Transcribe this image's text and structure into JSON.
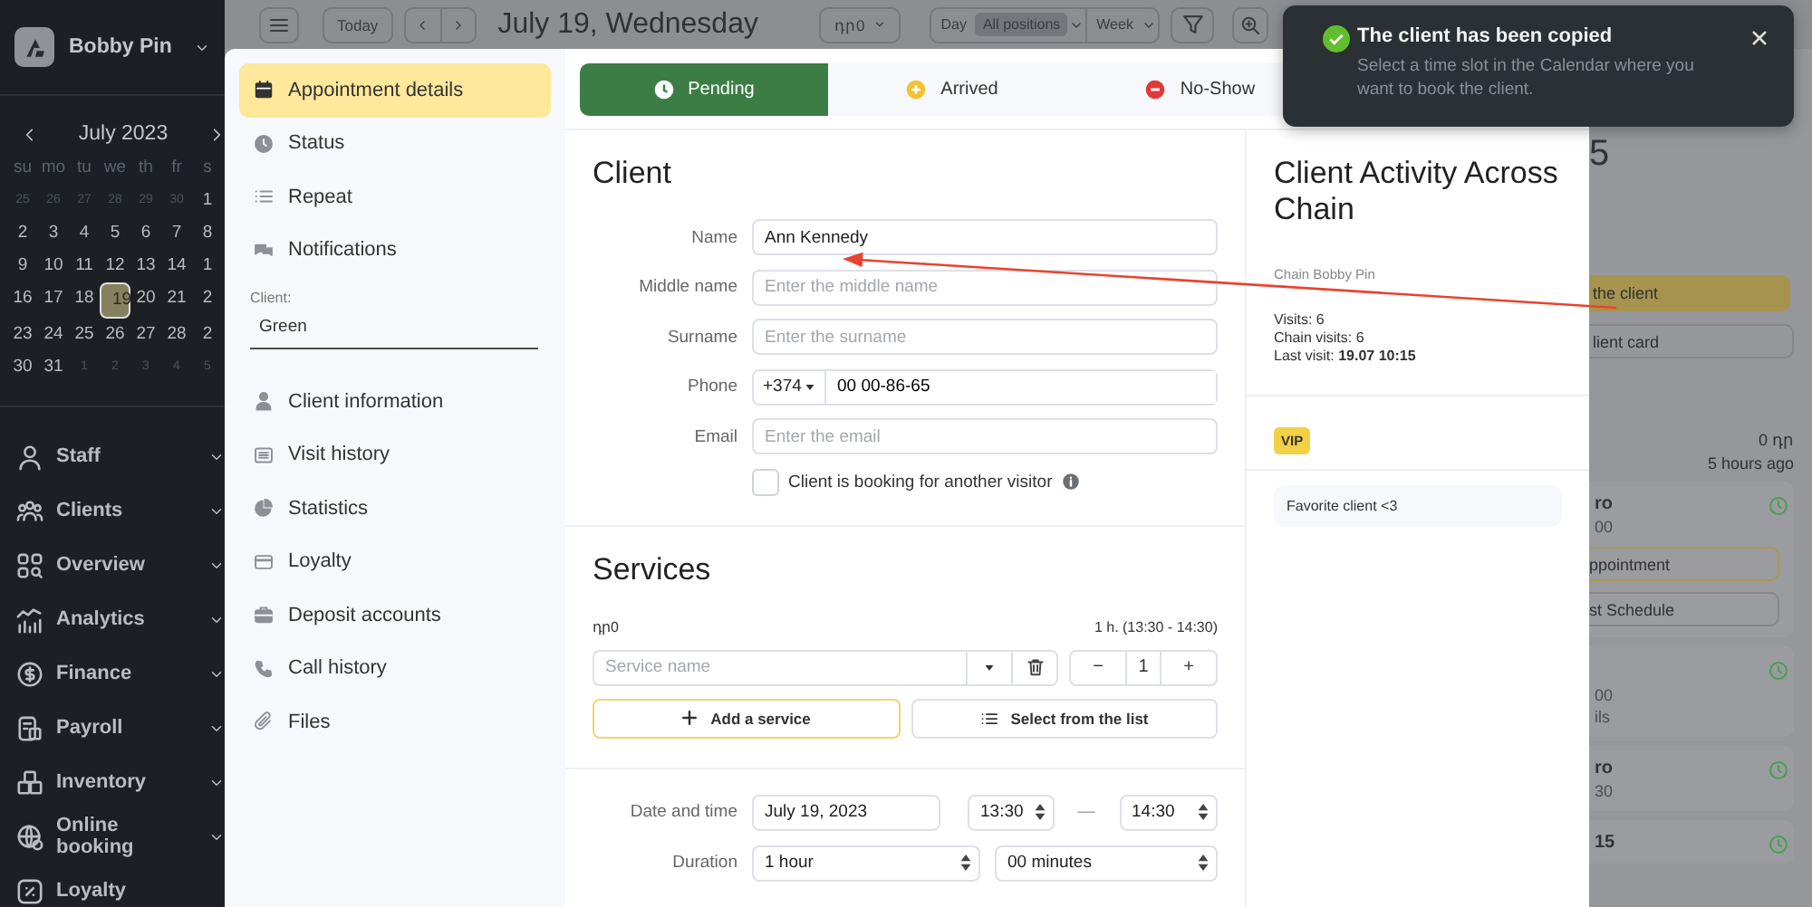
{
  "sidebar": {
    "business": "Bobby Pin",
    "calendar": {
      "month": "July 2023",
      "weekdays": [
        "su",
        "mo",
        "tu",
        "we",
        "th",
        "fr",
        "s"
      ],
      "weeks": [
        [
          {
            "day": "25",
            "muted": true,
            "selected": false
          },
          {
            "day": "26",
            "muted": true,
            "selected": false
          },
          {
            "day": "27",
            "muted": true,
            "selected": false
          },
          {
            "day": "28",
            "muted": true,
            "selected": false
          },
          {
            "day": "29",
            "muted": true,
            "selected": false
          },
          {
            "day": "30",
            "muted": true,
            "selected": false
          },
          {
            "day": "1",
            "muted": false,
            "selected": false
          }
        ],
        [
          {
            "day": "2",
            "muted": false,
            "selected": false
          },
          {
            "day": "3",
            "muted": false,
            "selected": false
          },
          {
            "day": "4",
            "muted": false,
            "selected": false
          },
          {
            "day": "5",
            "muted": false,
            "selected": false
          },
          {
            "day": "6",
            "muted": false,
            "selected": false
          },
          {
            "day": "7",
            "muted": false,
            "selected": false
          },
          {
            "day": "8",
            "muted": false,
            "selected": false
          }
        ],
        [
          {
            "day": "9",
            "muted": false,
            "selected": false
          },
          {
            "day": "10",
            "muted": false,
            "selected": false
          },
          {
            "day": "11",
            "muted": false,
            "selected": false
          },
          {
            "day": "12",
            "muted": false,
            "selected": false
          },
          {
            "day": "13",
            "muted": false,
            "selected": false
          },
          {
            "day": "14",
            "muted": false,
            "selected": false
          },
          {
            "day": "1",
            "muted": false,
            "selected": false
          }
        ],
        [
          {
            "day": "16",
            "muted": false,
            "selected": false
          },
          {
            "day": "17",
            "muted": false,
            "selected": false
          },
          {
            "day": "18",
            "muted": false,
            "selected": false
          },
          {
            "day": "19",
            "muted": false,
            "selected": true
          },
          {
            "day": "20",
            "muted": false,
            "selected": false
          },
          {
            "day": "21",
            "muted": false,
            "selected": false
          },
          {
            "day": "2",
            "muted": false,
            "selected": false
          }
        ],
        [
          {
            "day": "23",
            "muted": false,
            "selected": false
          },
          {
            "day": "24",
            "muted": false,
            "selected": false
          },
          {
            "day": "25",
            "muted": false,
            "selected": false
          },
          {
            "day": "26",
            "muted": false,
            "selected": false
          },
          {
            "day": "27",
            "muted": false,
            "selected": false
          },
          {
            "day": "28",
            "muted": false,
            "selected": false
          },
          {
            "day": "2",
            "muted": false,
            "selected": false
          }
        ],
        [
          {
            "day": "30",
            "muted": false,
            "selected": false
          },
          {
            "day": "31",
            "muted": false,
            "selected": false
          },
          {
            "day": "1",
            "muted": true,
            "selected": false
          },
          {
            "day": "2",
            "muted": true,
            "selected": false
          },
          {
            "day": "3",
            "muted": true,
            "selected": false
          },
          {
            "day": "4",
            "muted": true,
            "selected": false
          },
          {
            "day": "5",
            "muted": true,
            "selected": false
          }
        ]
      ]
    },
    "nav": [
      {
        "label": "Staff",
        "expandable": true
      },
      {
        "label": "Clients",
        "expandable": true
      },
      {
        "label": "Overview",
        "expandable": true
      },
      {
        "label": "Analytics",
        "expandable": true
      },
      {
        "label": "Finance",
        "expandable": true
      },
      {
        "label": "Payroll",
        "expandable": true
      },
      {
        "label": "Inventory",
        "expandable": true
      },
      {
        "label": "Online booking",
        "expandable": true
      },
      {
        "label": "Loyalty",
        "expandable": false
      }
    ]
  },
  "toolbar": {
    "today": "Today",
    "date_title": "July 19, Wednesday",
    "currency": "դր0",
    "segments": [
      {
        "label": "Day",
        "selected": false
      },
      {
        "label": "All positions",
        "selected": true
      }
    ],
    "week": "Week"
  },
  "background_panel": {
    "heading_fragment": "5",
    "copy_button": "the client",
    "card_button": "lient card",
    "balance": "0 դր",
    "last_seen": "5 hours ago",
    "appointments": [
      {
        "lines": [
          "ro",
          "00"
        ],
        "buttons": [
          {
            "label": "ppointment",
            "kind": "primary"
          },
          {
            "label": "st Schedule",
            "kind": "plain"
          }
        ]
      },
      {
        "lines": [
          "00",
          "ils"
        ]
      },
      {
        "lines": [
          "ro",
          "30"
        ]
      },
      {
        "lines": [
          "15"
        ]
      }
    ]
  },
  "modal": {
    "nav": [
      {
        "label": "Appointment details",
        "selected": true
      },
      {
        "label": "Status",
        "selected": false
      },
      {
        "label": "Repeat",
        "selected": false
      },
      {
        "label": "Notifications",
        "selected": false
      }
    ],
    "client_field": {
      "label": "Client:",
      "value": "Green"
    },
    "client_nav": [
      {
        "label": "Client information",
        "selected": false
      },
      {
        "label": "Visit history",
        "selected": false
      },
      {
        "label": "Statistics",
        "selected": false
      },
      {
        "label": "Loyalty",
        "selected": false
      },
      {
        "label": "Deposit accounts",
        "selected": false
      },
      {
        "label": "Call history",
        "selected": false
      },
      {
        "label": "Files",
        "selected": false
      }
    ],
    "statuses": [
      {
        "label": "Pending",
        "kind": "pending",
        "selected": true,
        "color": "#3c7d45"
      },
      {
        "label": "Arrived",
        "kind": "arrived",
        "selected": false,
        "color": "#f2c230"
      },
      {
        "label": "No-Show",
        "kind": "no_show",
        "selected": false,
        "color": "#e0393b"
      }
    ],
    "client": {
      "title": "Client",
      "fields": [
        {
          "label": "Name",
          "kind": "text",
          "value": "Ann Kennedy"
        },
        {
          "label": "Middle name",
          "kind": "text",
          "placeholder": "Enter the middle name"
        },
        {
          "label": "Surname",
          "kind": "text",
          "placeholder": "Enter the surname"
        },
        {
          "label": "Phone",
          "kind": "phone",
          "prefix": "+374",
          "value": "00 00-86-65"
        },
        {
          "label": "Email",
          "kind": "text",
          "placeholder": "Enter the email"
        }
      ],
      "another_visitor": {
        "label": "Client is booking for another visitor",
        "checked": false
      }
    },
    "services": {
      "title": "Services",
      "currency": "դր0",
      "timing": "1 h. (13:30 - 14:30)",
      "service_placeholder": "Service name",
      "minus": "−",
      "quantity": "1",
      "plus": "+",
      "add_button": "Add a service",
      "list_button": "Select from the list"
    },
    "schedule": {
      "date_label": "Date and time",
      "date": "July 19, 2023",
      "start": "13:30",
      "separator": "—",
      "end": "14:30",
      "duration_label": "Duration",
      "hours": "1 hour",
      "minutes": "00 minutes"
    },
    "activity": {
      "title": "Client Activity Across Chain",
      "chain": "Chain Bobby Pin",
      "stats": [
        "Visits: 6",
        "Chain visits: 6",
        "Last visit: **19.07 10:15**"
      ],
      "tag": "VIP",
      "note": "Favorite client <3"
    }
  },
  "toast": {
    "title": "The client has been copied",
    "message": "Select a time slot in the Calendar where you want to book the client."
  }
}
